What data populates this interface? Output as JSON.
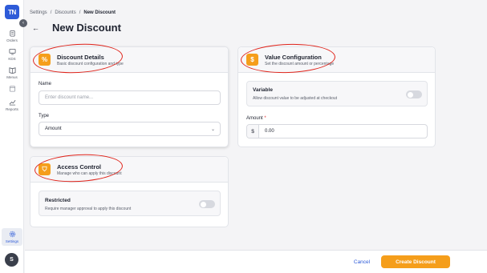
{
  "brand": {
    "logo_text": "TN",
    "accent": "#f59e1b",
    "primary": "#2e5bd8"
  },
  "sidebar": {
    "items": [
      {
        "label": "Orders",
        "icon": "clipboard-icon"
      },
      {
        "label": "KDS",
        "icon": "monitor-icon"
      },
      {
        "label": "Menus",
        "icon": "book-icon"
      },
      {
        "label": "",
        "icon": "calendar-icon"
      },
      {
        "label": "Reports",
        "icon": "chart-icon"
      },
      {
        "label": "Settings",
        "icon": "gear-icon"
      }
    ],
    "avatar_initial": "S"
  },
  "breadcrumb": {
    "items": [
      "Settings",
      "Discounts",
      "New Discount"
    ],
    "separator": "/"
  },
  "page": {
    "title": "New Discount"
  },
  "discount_details": {
    "title": "Discount Details",
    "subtitle": "Basic discount configuration and type",
    "name_label": "Name",
    "name_placeholder": "Enter discount name...",
    "name_value": "",
    "type_label": "Type",
    "type_value": "Amount"
  },
  "value_config": {
    "title": "Value Configuration",
    "subtitle": "Set the discount amount or percentage",
    "variable_title": "Variable",
    "variable_desc": "Allow discount value to be adjusted at checkout",
    "variable_on": false,
    "amount_label": "Amount",
    "amount_required": "*",
    "currency": "$",
    "amount_value": "0.00"
  },
  "access_control": {
    "title": "Access Control",
    "subtitle": "Manage who can apply this discount",
    "restricted_title": "Restricted",
    "restricted_desc": "Require manager approval to apply this discount",
    "restricted_on": false
  },
  "footer": {
    "cancel_label": "Cancel",
    "create_label": "Create Discount"
  }
}
